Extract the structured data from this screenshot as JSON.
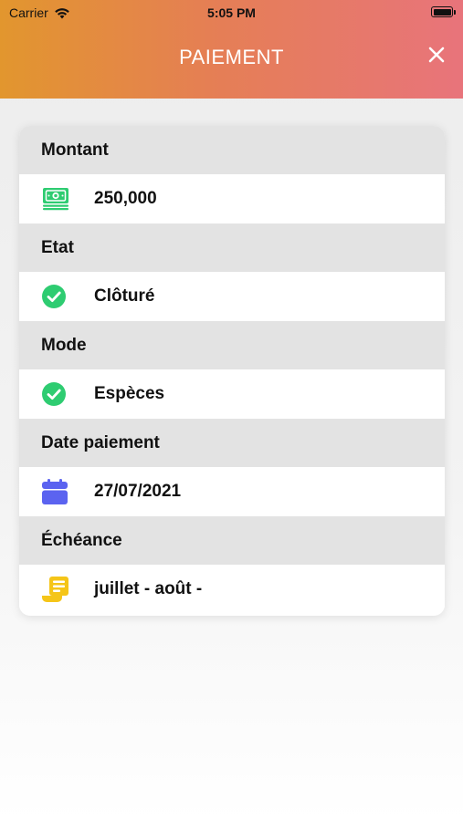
{
  "status_bar": {
    "carrier": "Carrier",
    "time": "5:05 PM"
  },
  "header": {
    "title": "PAIEMENT",
    "close_icon": "close-icon"
  },
  "sections": [
    {
      "label": "Montant",
      "value": "250,000",
      "icon": "money-icon",
      "icon_color": "#2ecc71"
    },
    {
      "label": "Etat",
      "value": "Clôturé",
      "icon": "check-circle-icon",
      "icon_color": "#2ecc71"
    },
    {
      "label": "Mode",
      "value": "Espèces",
      "icon": "check-circle-icon",
      "icon_color": "#2ecc71"
    },
    {
      "label": "Date paiement",
      "value": "27/07/2021",
      "icon": "calendar-icon",
      "icon_color": "#5b63f0"
    },
    {
      "label": "Échéance",
      "value": "juillet - août -",
      "icon": "receipt-icon",
      "icon_color": "#f5c518"
    }
  ],
  "colors": {
    "header_start": "#e2962e",
    "header_end": "#e8747b",
    "section_header_bg": "#e3e3e3"
  }
}
